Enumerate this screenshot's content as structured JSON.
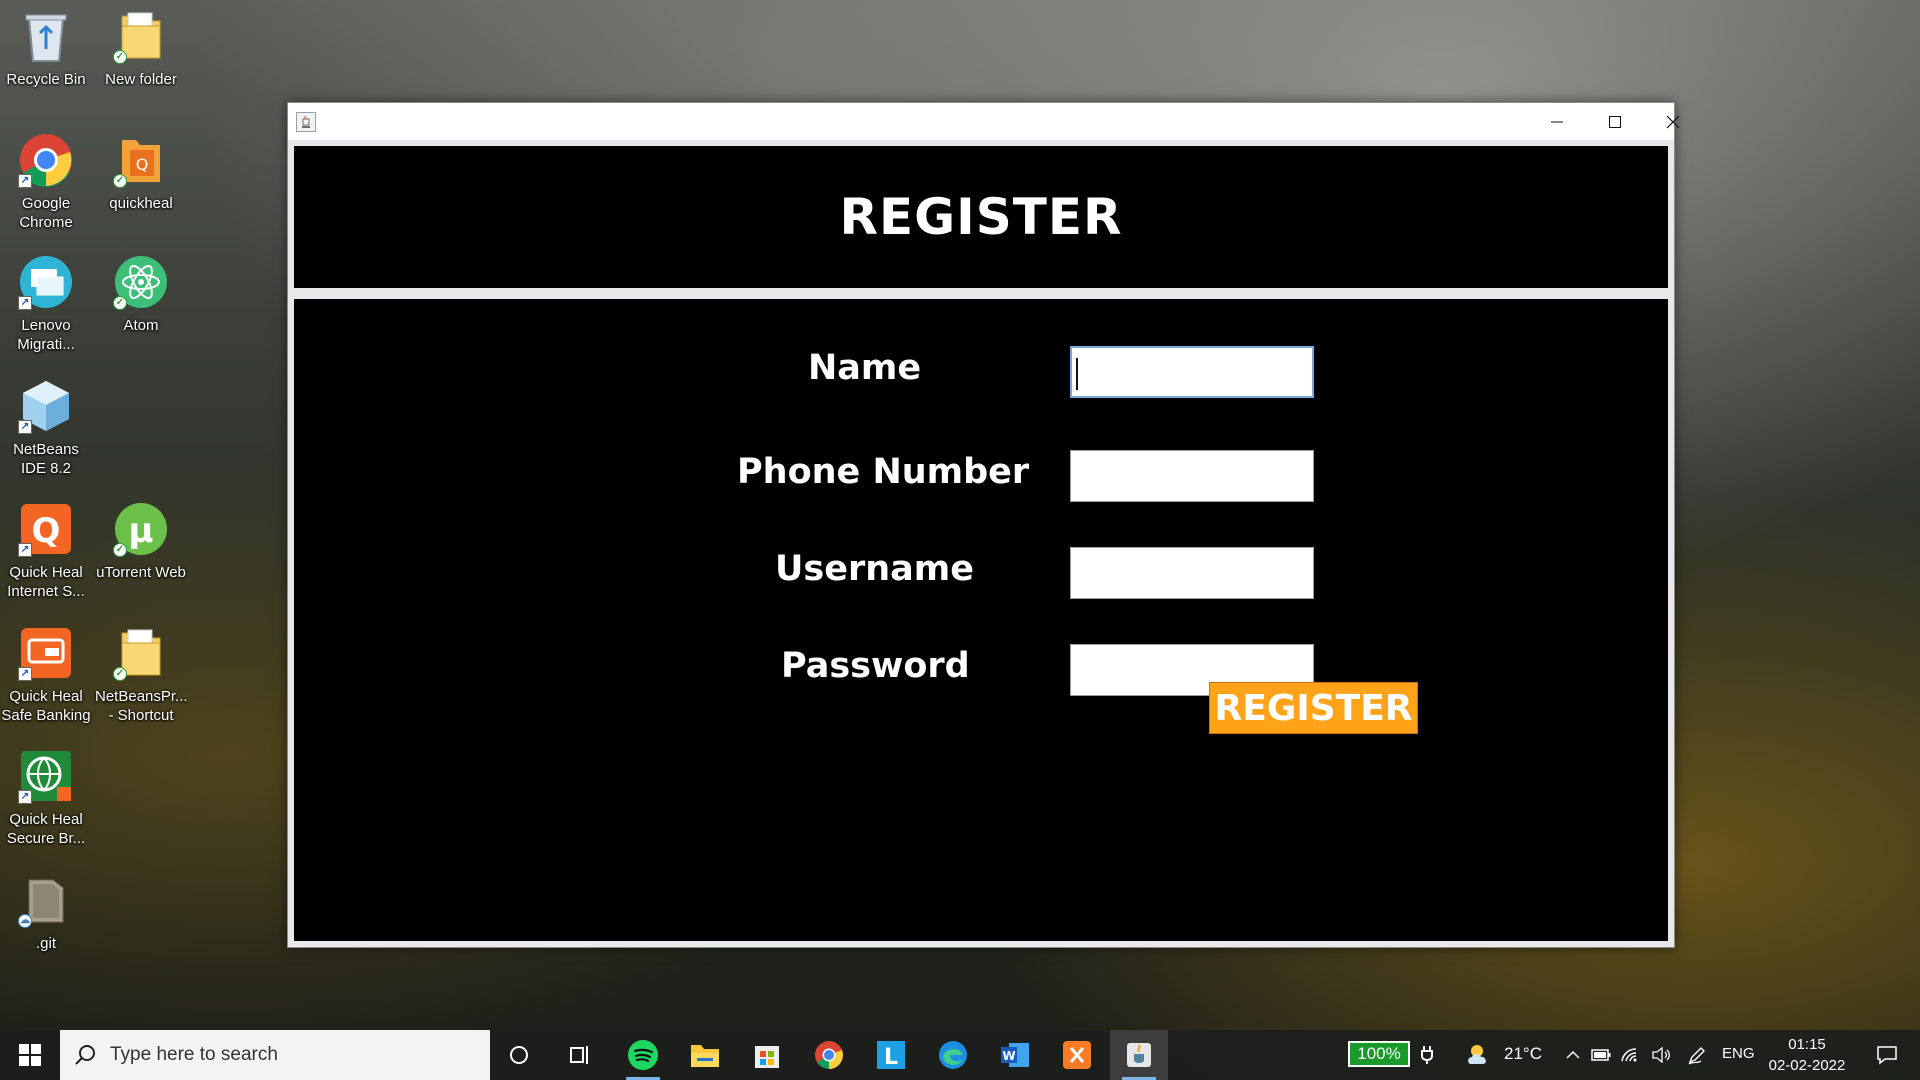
{
  "desktop": {
    "icons": [
      {
        "label": "Recycle Bin",
        "icon": "recycle-bin-icon"
      },
      {
        "label": "New folder",
        "icon": "folder-icon"
      },
      {
        "label": "Google Chrome",
        "icon": "chrome-icon"
      },
      {
        "label": "quickheal",
        "icon": "quickheal-icon"
      },
      {
        "label": "Lenovo Migrati...",
        "icon": "lenovo-migration-icon"
      },
      {
        "label": "Atom",
        "icon": "atom-icon"
      },
      {
        "label": "NetBeans IDE 8.2",
        "icon": "netbeans-icon"
      },
      {
        "label": "Quick Heal Internet S...",
        "icon": "quickheal-internet-security-icon"
      },
      {
        "label": "uTorrent Web",
        "icon": "utorrent-icon"
      },
      {
        "label": "Quick Heal Safe Banking",
        "icon": "safe-banking-icon"
      },
      {
        "label": "NetBeansPr... - Shortcut",
        "icon": "folder-shortcut-icon"
      },
      {
        "label": "Quick Heal Secure Br...",
        "icon": "secure-browser-icon"
      },
      {
        "label": ".git",
        "icon": "git-folder-icon"
      }
    ]
  },
  "window": {
    "header_title": "REGISTER",
    "fields": [
      {
        "label": "Name",
        "value": ""
      },
      {
        "label": "Phone Number",
        "value": ""
      },
      {
        "label": "Username",
        "value": ""
      },
      {
        "label": "Password",
        "value": ""
      }
    ],
    "register_button": "REGISTER"
  },
  "taskbar": {
    "search_placeholder": "Type here to search",
    "battery": "100%",
    "weather": "21°C",
    "language": "ENG",
    "time": "01:15",
    "date": "02-02-2022",
    "apps": [
      "task-view-icon",
      "spotify-icon",
      "file-explorer-icon",
      "microsoft-store-icon",
      "chrome-icon",
      "l-app-icon",
      "edge-icon",
      "word-icon",
      "xampp-icon",
      "java-icon"
    ]
  },
  "colors": {
    "panel_bg": "#000000",
    "button_bg": "#ffa31a",
    "battery_green": "#1a9a2a"
  }
}
